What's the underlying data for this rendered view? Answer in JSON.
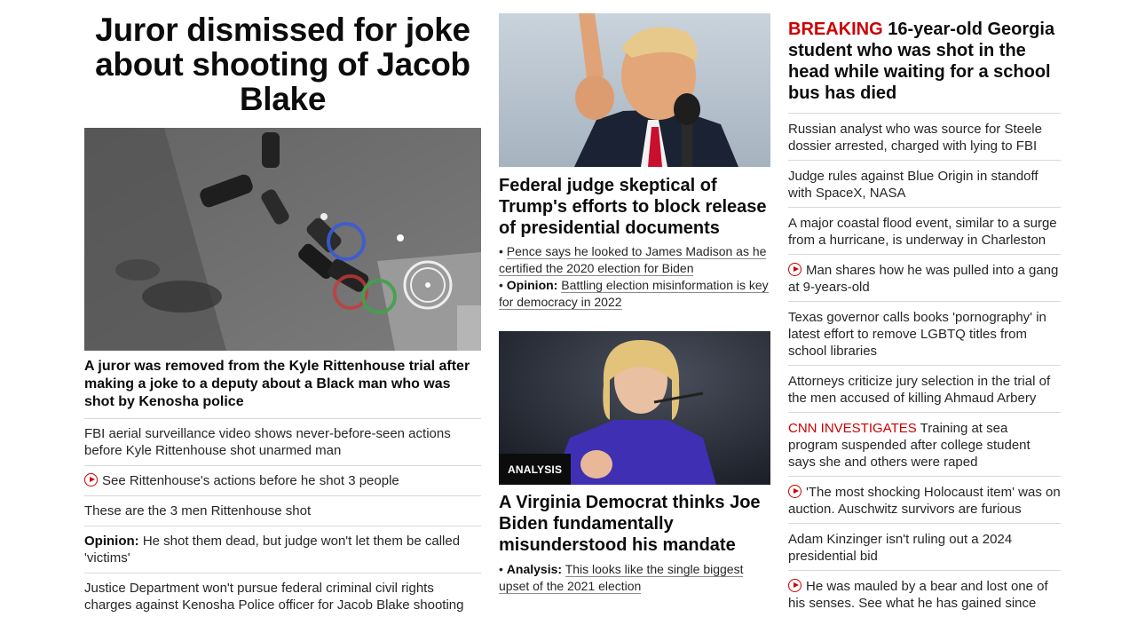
{
  "left": {
    "headline": "Juror dismissed for joke about shooting of Jacob Blake",
    "subheadline": "A juror was removed from the Kyle Rittenhouse trial after making a joke to a deputy about a Black man who was shot by Kenosha police",
    "items": [
      {
        "text": "FBI aerial surveillance video shows never-before-seen actions before Kyle Rittenhouse shot unarmed man"
      },
      {
        "text": "See Rittenhouse's actions before he shot 3 people",
        "icon": "play-circle-icon"
      },
      {
        "text": "These are the 3 men Rittenhouse shot"
      },
      {
        "prefix": "Opinion:",
        "text": " He shot them dead, but judge won't let them be called 'victims'"
      },
      {
        "text": "Justice Department won't pursue federal criminal civil rights charges against Kenosha Police officer for Jacob Blake shooting"
      }
    ]
  },
  "middle": {
    "story1": {
      "headline": "Federal judge skeptical of Trump's efforts to block release of presidential documents",
      "bullets": [
        {
          "prefix": "",
          "text": "Pence says he looked to James Madison as he certified the 2020 election for Biden"
        },
        {
          "prefix": "Opinion:",
          "text": "Battling election misinformation is key for democracy in 2022"
        }
      ]
    },
    "story2": {
      "tag": "ANALYSIS",
      "headline": "A Virginia Democrat thinks Joe Biden fundamentally misunderstood his mandate",
      "bullets": [
        {
          "prefix": "Analysis:",
          "text": "This looks like the single biggest upset of the 2021 election"
        }
      ]
    }
  },
  "right": {
    "breaking_tag": "BREAKING",
    "breaking_text": "16-year-old Georgia student who was shot in the head while waiting for a school bus has died",
    "items": [
      {
        "text": "Russian analyst who was source for Steele dossier arrested, charged with lying to FBI"
      },
      {
        "text": "Judge rules against Blue Origin in standoff with SpaceX, NASA"
      },
      {
        "text": "A major coastal flood event, similar to a surge from a hurricane, is underway in Charleston"
      },
      {
        "text": "Man shares how he was pulled into a gang at 9-years-old",
        "icon": "play-circle-icon"
      },
      {
        "text": "Texas governor calls books 'pornography' in latest effort to remove LGBTQ titles from school libraries"
      },
      {
        "text": "Attorneys criticize jury selection in the trial of the men accused of killing Ahmaud Arbery"
      },
      {
        "prefix": "CNN INVESTIGATES",
        "text": " Training at sea program suspended after college student says she and others were raped"
      },
      {
        "text": "'The most shocking Holocaust item' was on auction. Auschwitz survivors are furious",
        "icon": "play-circle-icon"
      },
      {
        "text": "Adam Kinzinger isn't ruling out a 2024 presidential bid"
      },
      {
        "text": "He was mauled by a bear and lost one of his senses. See what he has gained since",
        "icon": "play-circle-icon"
      }
    ]
  },
  "colors": {
    "accent_red": "#cc0000",
    "text": "#0c0c0c",
    "divider": "#d9d9d9"
  }
}
